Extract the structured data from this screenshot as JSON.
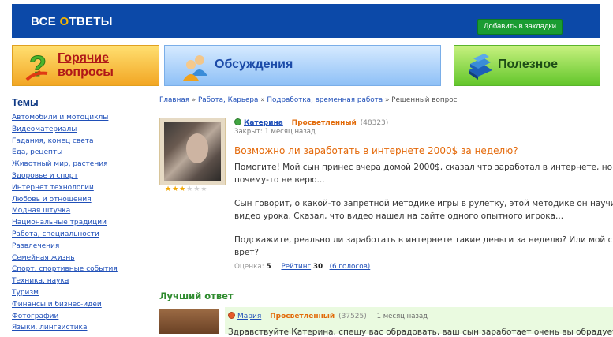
{
  "header": {
    "logo_prefix": "ВСЕ ",
    "logo_o": "О",
    "logo_suffix": "ТВЕТЫ",
    "bookmark_label": "Добавить в закладки"
  },
  "tiles": {
    "hot_label": "Горячие вопросы",
    "discussions_label": "Обсуждения",
    "useful_label": "Полезное"
  },
  "sidebar": {
    "title": "Темы",
    "items": [
      "Автомобили и мотоциклы",
      "Видеоматериалы",
      "Гадания, конец света",
      "Еда, рецепты",
      "Животный мир, растения",
      "Здоровье и спорт",
      "Интернет технологии",
      "Любовь и отношения",
      "Модная штучка",
      "Национальные традиции",
      "Работа, специальности",
      "Развлечения",
      "Семейная жизнь",
      "Спорт, спортивные события",
      "Техника, наука",
      "Туризм",
      "Финансы и бизнес-идеи",
      "Фотографии",
      "Языки, лингвистика"
    ]
  },
  "breadcrumb": {
    "home": "Главная",
    "cat": "Работа, Карьера",
    "subcat": "Подработка, временная работа",
    "current": "Решенный вопрос",
    "sep": "»"
  },
  "question": {
    "author": "Катерина",
    "rank": "Просветленный",
    "points": "(48323)",
    "closed": "Закрыт: 1 месяц назад",
    "title": "Возможно ли заработать в интернете 2000$ за неделю?",
    "p1a": "Помогите! Мой сын принес вчера домой 2000$, сказал что заработал в интернете, но я ем",
    "p1b": "почему-то не верю...",
    "p2a": "Сын говорит, о какой-то запретной методике игры в рулетку, этой методике он научился с",
    "p2b": "видео урока. Сказал, что видео нашел на сайте одного опытного игрока...",
    "p3a": "Подскажите, реально ли заработать в интернете такие деньги за неделю? Или мой сын м",
    "p3b": "врет?",
    "stars": 3,
    "stars_max": 6,
    "score_label": "Оценка:",
    "score": "5",
    "rating_label": "Рейтинг",
    "rating": "30",
    "votes": "(6 голосов)"
  },
  "best_answer": {
    "heading": "Лучший ответ",
    "author": "Мария",
    "rank": "Просветленный",
    "points": "(37525)",
    "time": "1 месяц назад",
    "text": "Здравствуйте Катерина, спешу вас обрадовать, ваш сын заработает очень вы обрадуетесь"
  },
  "colors": {
    "header_bg": "#0c49a8",
    "accent_orange": "#e4690a",
    "link": "#1f4fb8",
    "best_green": "#2e8b2e"
  }
}
